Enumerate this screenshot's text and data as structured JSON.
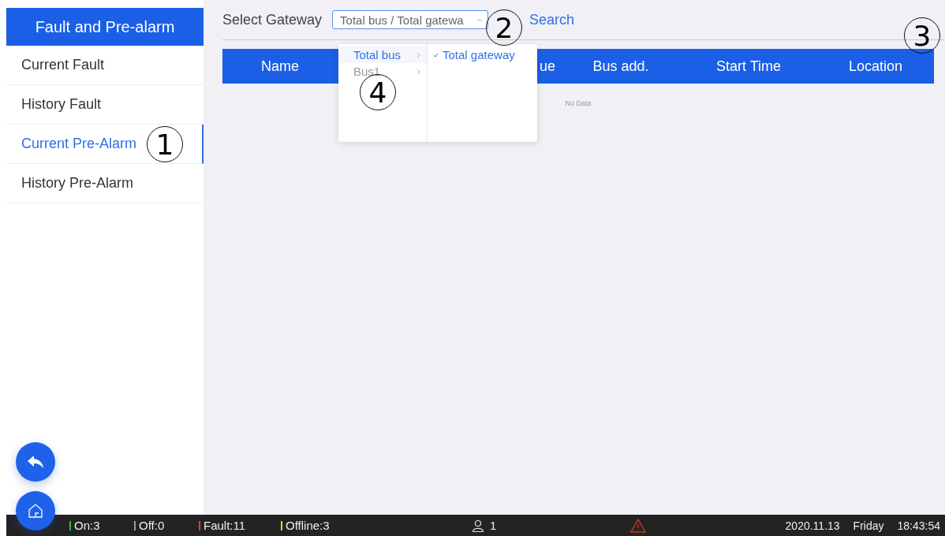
{
  "sidebar": {
    "title": "Fault and Pre-alarm",
    "items": [
      {
        "label": "Current Fault",
        "selected": false
      },
      {
        "label": "History Fault",
        "selected": false
      },
      {
        "label": "Current Pre-Alarm",
        "selected": true
      },
      {
        "label": "History Pre-Alarm",
        "selected": false
      }
    ]
  },
  "toolbar": {
    "label": "Select Gateway",
    "select_value": "Total bus / Total gatewa",
    "search": "Search"
  },
  "cascader": {
    "columns": [
      [
        {
          "label": "Total bus",
          "selected": true
        },
        {
          "label": "Bus1",
          "selected": false
        }
      ],
      [
        {
          "label": "Total gateway",
          "selected": true
        }
      ]
    ]
  },
  "table": {
    "columns": [
      "Name",
      "ue",
      "Bus add.",
      "Start Time",
      "Location"
    ],
    "empty_text": "No Data"
  },
  "status_bar": {
    "counters": [
      {
        "label": "On:3",
        "color": "#2db84d"
      },
      {
        "label": "Off:0",
        "color": "#9a9a9a"
      },
      {
        "label": "Fault:11",
        "color": "#e0401e"
      },
      {
        "label": "Offline:3",
        "color": "#f2d21b"
      }
    ],
    "users": "1",
    "date": "2020.11.13",
    "day": "Friday",
    "time": "18:43:54"
  },
  "callouts": [
    "1",
    "2",
    "3",
    "4"
  ]
}
